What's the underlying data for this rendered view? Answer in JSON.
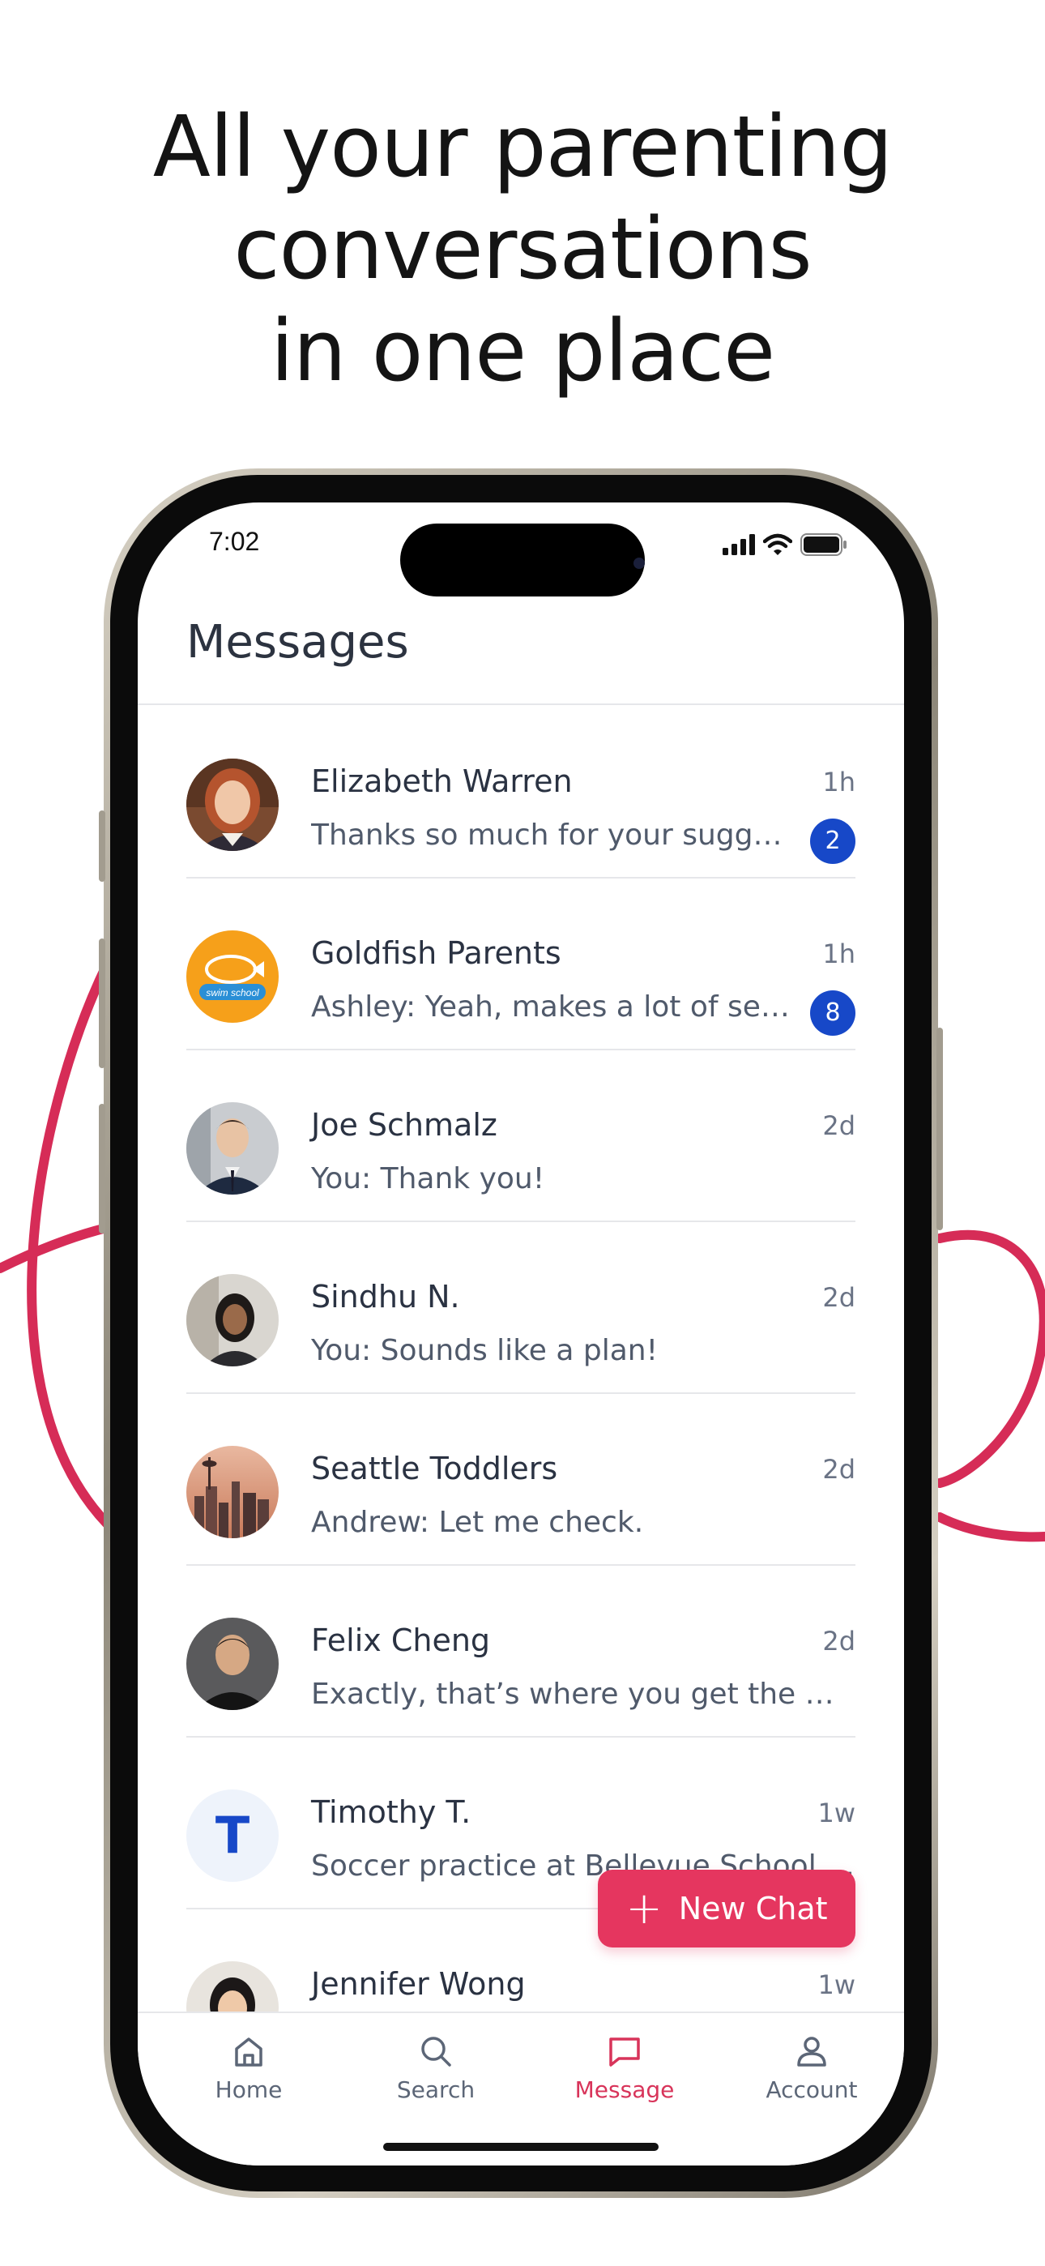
{
  "headline": {
    "line1": "All your parenting",
    "line2": "conversations",
    "line3": "in one place"
  },
  "status_bar": {
    "time": "7:02"
  },
  "page_title": "Messages",
  "conversations": [
    {
      "name": "Elizabeth  Warren",
      "time": "1h",
      "preview": "Thanks so much for your suggesti...",
      "unread": "2",
      "avatar": "photo-woman-red-hair"
    },
    {
      "name": "Goldfish Parents",
      "time": "1h",
      "preview": "Ashley: Yeah, makes a lot of sense...",
      "unread": "8",
      "avatar": "goldfish-swim-school-logo",
      "logo_text": "swim school"
    },
    {
      "name": "Joe Schmalz",
      "time": "2d",
      "preview": "You: Thank you!",
      "avatar": "photo-man-suit"
    },
    {
      "name": "Sindhu N.",
      "time": "2d",
      "preview": "You: Sounds like a plan!",
      "avatar": "photo-woman-dark-hair"
    },
    {
      "name": "Seattle Toddlers",
      "time": "2d",
      "preview": "Andrew: Let me check.",
      "avatar": "photo-seattle-skyline"
    },
    {
      "name": "Felix Cheng",
      "time": "2d",
      "preview": "Exactly, that’s where you get the most...",
      "avatar": "photo-man-dark-shirt"
    },
    {
      "name": "Timothy T.",
      "time": "1w",
      "preview": "Soccer practice at Bellevue School Gr...",
      "avatar_letter": "T"
    },
    {
      "name": "Jennifer Wong",
      "time": "1w",
      "preview": "",
      "avatar": "photo-woman-smiling"
    }
  ],
  "fab": {
    "label": "New Chat",
    "icon": "plus-icon"
  },
  "tabs": [
    {
      "label": "Home",
      "icon": "home-icon"
    },
    {
      "label": "Search",
      "icon": "search-icon"
    },
    {
      "label": "Message",
      "icon": "message-icon",
      "active": true
    },
    {
      "label": "Account",
      "icon": "account-icon"
    }
  ],
  "colors": {
    "accent": "#e5365f",
    "badge": "#1748c8",
    "text_primary": "#2a3242",
    "text_secondary": "#505a6b",
    "decoration": "#d62c57"
  }
}
